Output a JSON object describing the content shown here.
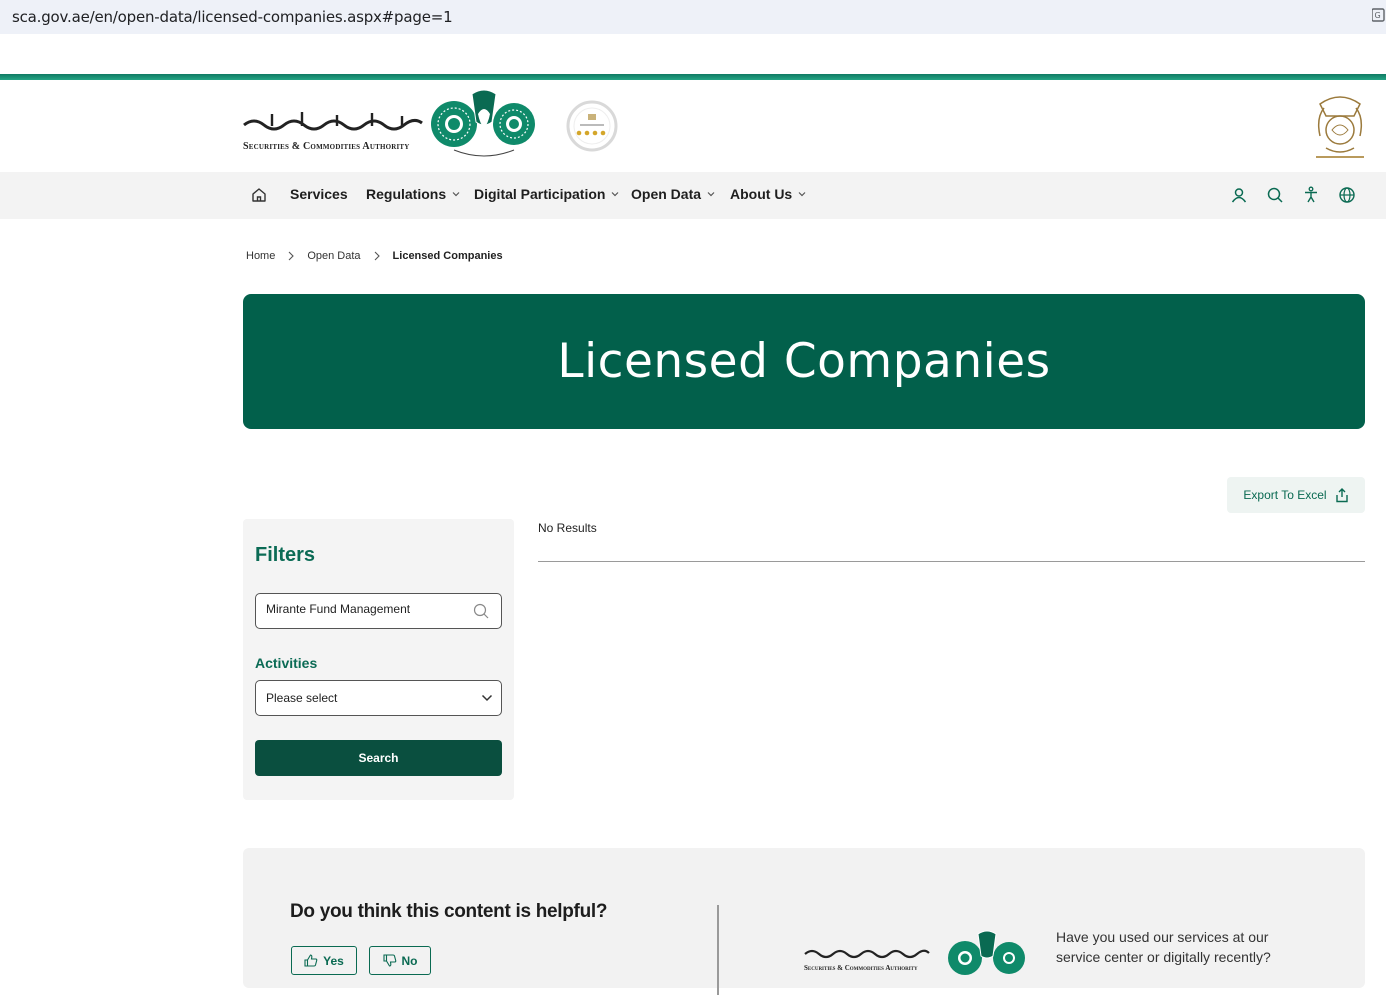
{
  "browser": {
    "url": "sca.gov.ae/en/open-data/licensed-companies.aspx#page=1"
  },
  "header": {
    "logo_text_en": "Securities & Commodities Authority"
  },
  "nav": {
    "items": [
      {
        "label": "Services"
      },
      {
        "label": "Regulations"
      },
      {
        "label": "Digital Participation"
      },
      {
        "label": "Open Data"
      },
      {
        "label": "About Us"
      }
    ]
  },
  "breadcrumb": {
    "items": [
      "Home",
      "Open Data",
      "Licensed Companies"
    ]
  },
  "hero": {
    "title": "Licensed Companies"
  },
  "toolbar": {
    "export_label": "Export To Excel"
  },
  "filters": {
    "title": "Filters",
    "search_value": "Mirante Fund Management",
    "activities_label": "Activities",
    "activities_selected": "Please select",
    "search_button": "Search"
  },
  "results": {
    "status": "No Results"
  },
  "feedback": {
    "question": "Do you think this content is helpful?",
    "yes_label": "Yes",
    "no_label": "No",
    "service_question": "Have you used our services at our service center or digitally recently?"
  },
  "colors": {
    "primary_green": "#02604b",
    "accent_green": "#0a6a52",
    "dark_button": "#0a4f3f"
  }
}
